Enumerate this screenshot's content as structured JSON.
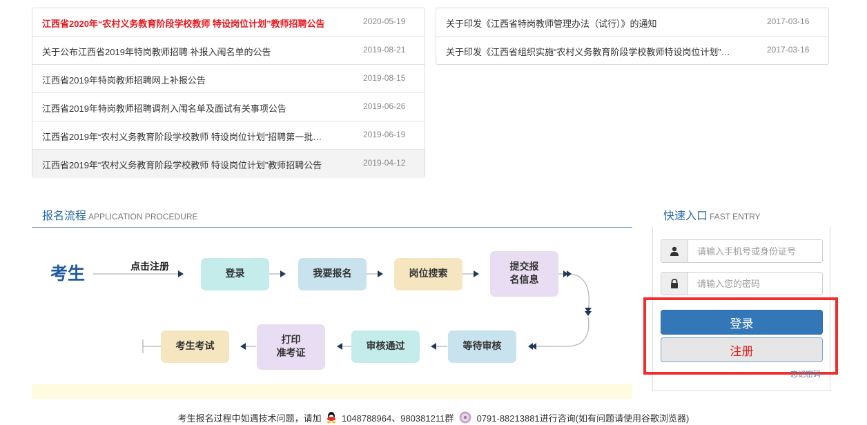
{
  "news_left": [
    {
      "title": "江西省2020年“农村义务教育阶段学校教师 特设岗位计划”教师招聘公告",
      "date": "2020-05-19"
    },
    {
      "title": "关于公布江西省2019年特岗教师招聘 补报入闱名单的公告",
      "date": "2019-08-21"
    },
    {
      "title": "江西省2019年特岗教师招聘网上补报公告",
      "date": "2019-08-15"
    },
    {
      "title": "江西省2019年特岗教师招聘调剂入闱名单及面试有关事项公告",
      "date": "2019-06-26"
    },
    {
      "title": "江西省2019年“农村义务教育阶段学校教师 特设岗位计划”招聘第一批…",
      "date": "2019-06-19"
    },
    {
      "title": "江西省2019年“农村义务教育阶段学校教师 特设岗位计划”教师招聘公告",
      "date": "2019-04-12"
    }
  ],
  "news_right": [
    {
      "title": "关于印发《江西省特岗教师管理办法（试行）》的通知",
      "date": "2017-03-16"
    },
    {
      "title": "关于印发《江西省组织实施“农村义务教育阶段学校教师特设岗位计划”…",
      "date": "2017-03-16"
    }
  ],
  "procedure": {
    "title": "报名流程",
    "title_en": "APPLICATION PROCEDURE",
    "start_label": "考生",
    "click_label": "点击注册",
    "steps": {
      "login": "登录",
      "apply": "我要报名",
      "search": "岗位搜索",
      "submit": "提交报\n名信息",
      "wait": "等待审核",
      "pass": "审核通过",
      "print": "打印\n准考证",
      "exam": "考生考试"
    }
  },
  "fast_entry": {
    "title": "快速入口",
    "title_en": "FAST ENTRY",
    "username_placeholder": "请输入手机号或身份证号",
    "password_placeholder": "请输入您的密码",
    "login_label": "登录",
    "register_label": "注册",
    "forgot_label": "忘记密码"
  },
  "footer": {
    "text_before": "考生报名过程中如遇技术问题，请加",
    "qq": "1048788964、980381211群",
    "phone": "0791-88213881进行咨询(如有问题请使用谷歌浏览器)"
  },
  "colors": {
    "accent": "#3477b9",
    "hot_title": "#e4181f",
    "highlight_frame": "#ef2d2d",
    "register_text": "#e01b1b"
  }
}
